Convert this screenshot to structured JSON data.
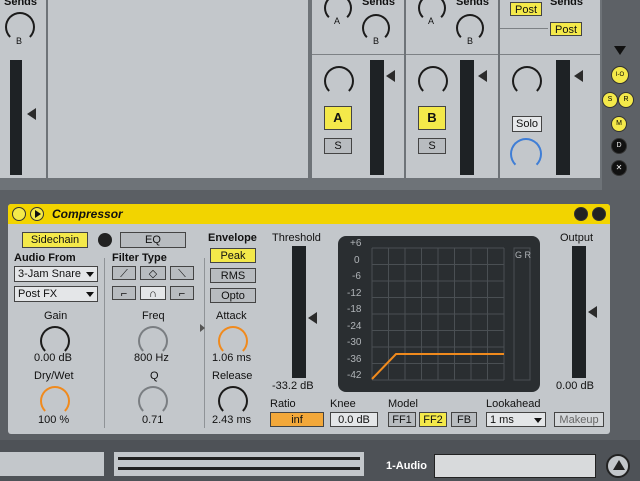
{
  "mixer": {
    "sends_label": "Sends",
    "send_a": "A",
    "send_b": "B",
    "track_a": "A",
    "track_b": "B",
    "solo_s": "S",
    "post1": "Post",
    "post2": "Post",
    "solo_label": "Solo",
    "side_buttons": [
      "I-O",
      "S",
      "R",
      "M",
      "D",
      "✕"
    ]
  },
  "device": {
    "title": "Compressor",
    "sidechain": "Sidechain",
    "eq": "EQ",
    "audio_from": "Audio From",
    "audio_source": "3-Jam Snare",
    "post_fx": "Post FX",
    "filter_type": "Filter Type",
    "gain_label": "Gain",
    "gain_value": "0.00 dB",
    "drywet_label": "Dry/Wet",
    "drywet_value": "100 %",
    "freq_label": "Freq",
    "freq_value": "800 Hz",
    "q_label": "Q",
    "q_value": "0.71",
    "envelope_label": "Envelope",
    "peak": "Peak",
    "rms": "RMS",
    "opto": "Opto",
    "attack_label": "Attack",
    "attack_value": "1.06 ms",
    "release_label": "Release",
    "release_value": "2.43 ms",
    "threshold_label": "Threshold",
    "threshold_value": "-33.2 dB",
    "output_label": "Output",
    "output_value": "0.00 dB",
    "gr_label": "G R",
    "graph_ticks": [
      "+6",
      "0",
      "-6",
      "-12",
      "-18",
      "-24",
      "-30",
      "-36",
      "-42"
    ],
    "ratio_label": "Ratio",
    "ratio_value": "inf",
    "knee_label": "Knee",
    "knee_value": "0.0 dB",
    "model_label": "Model",
    "models": [
      "FF1",
      "FF2",
      "FB"
    ],
    "lookahead_label": "Lookahead",
    "lookahead_value": "1 ms",
    "makeup": "Makeup"
  },
  "bottom": {
    "track_name": "1-Audio"
  },
  "colors": {
    "accent_yellow": "#f4e94a",
    "title_bar": "#f2d400",
    "orange": "#f08a1d",
    "blue_knob": "#3f7ed6"
  }
}
